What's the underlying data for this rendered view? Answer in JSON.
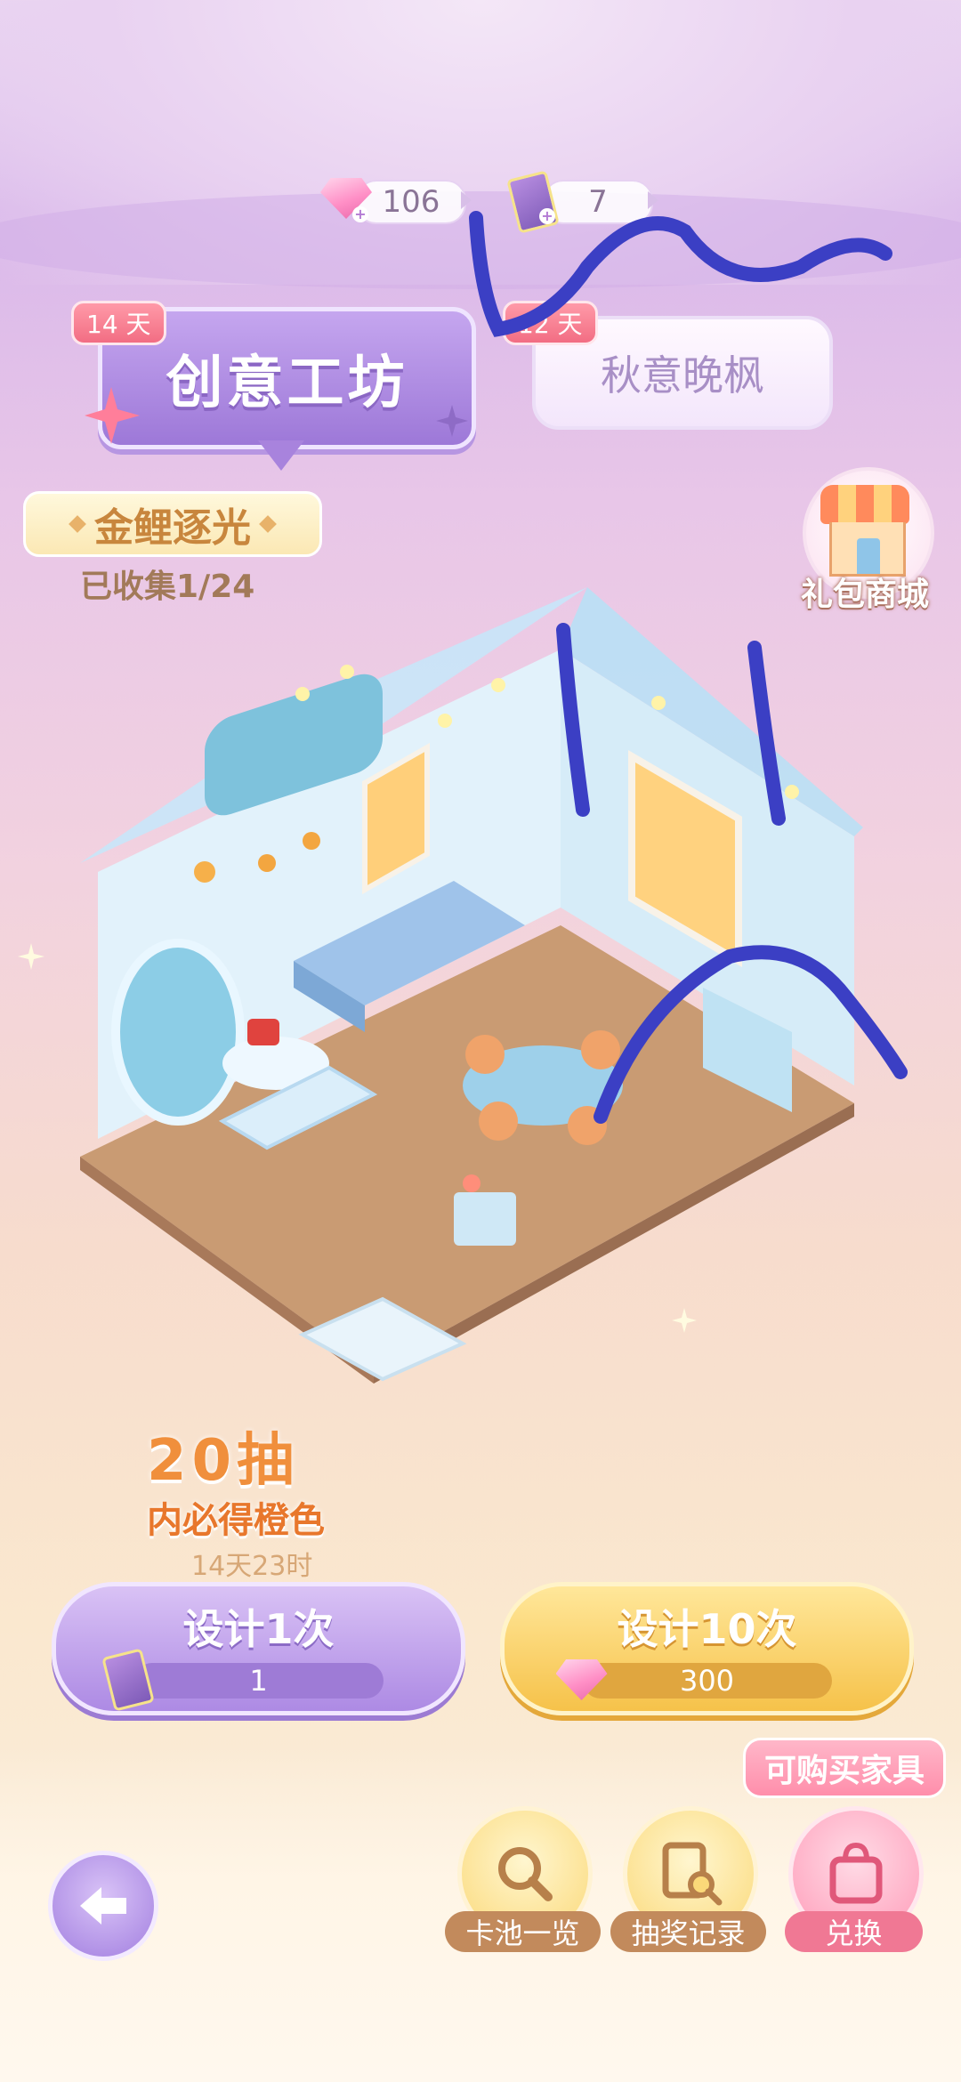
{
  "currencies": [
    {
      "icon": "pink-gem-icon",
      "value": "106"
    },
    {
      "icon": "design-card-icon",
      "value": "7"
    }
  ],
  "banners": {
    "main": {
      "days_tag": "14 天",
      "title": "创意工坊"
    },
    "side": {
      "days_tag": "12 天",
      "title": "秋意晚枫"
    }
  },
  "collection": {
    "name": "金鲤逐光",
    "progress": "已收集1/24"
  },
  "shop": {
    "label": "礼包商城"
  },
  "guarantee": {
    "line1": "20抽",
    "line2": "内必得橙色"
  },
  "timer": "14天23时",
  "draw_buttons": [
    {
      "label": "设计1次",
      "cost": "1",
      "cost_icon": "design-card-icon"
    },
    {
      "label": "设计10次",
      "cost": "300",
      "cost_icon": "pink-gem-icon"
    }
  ],
  "badge": "可购买家具",
  "bottom_actions": [
    {
      "label": "卡池一览",
      "icon": "magnifier-sparkle-icon"
    },
    {
      "label": "抽奖记录",
      "icon": "record-search-icon"
    },
    {
      "label": "兑换",
      "icon": "shopping-bag-icon"
    }
  ],
  "colors": {
    "accent_purple": "#a883dd",
    "accent_gold": "#f6c24a",
    "accent_pink": "#ff8eab",
    "scribble": "#3b3fc4"
  }
}
